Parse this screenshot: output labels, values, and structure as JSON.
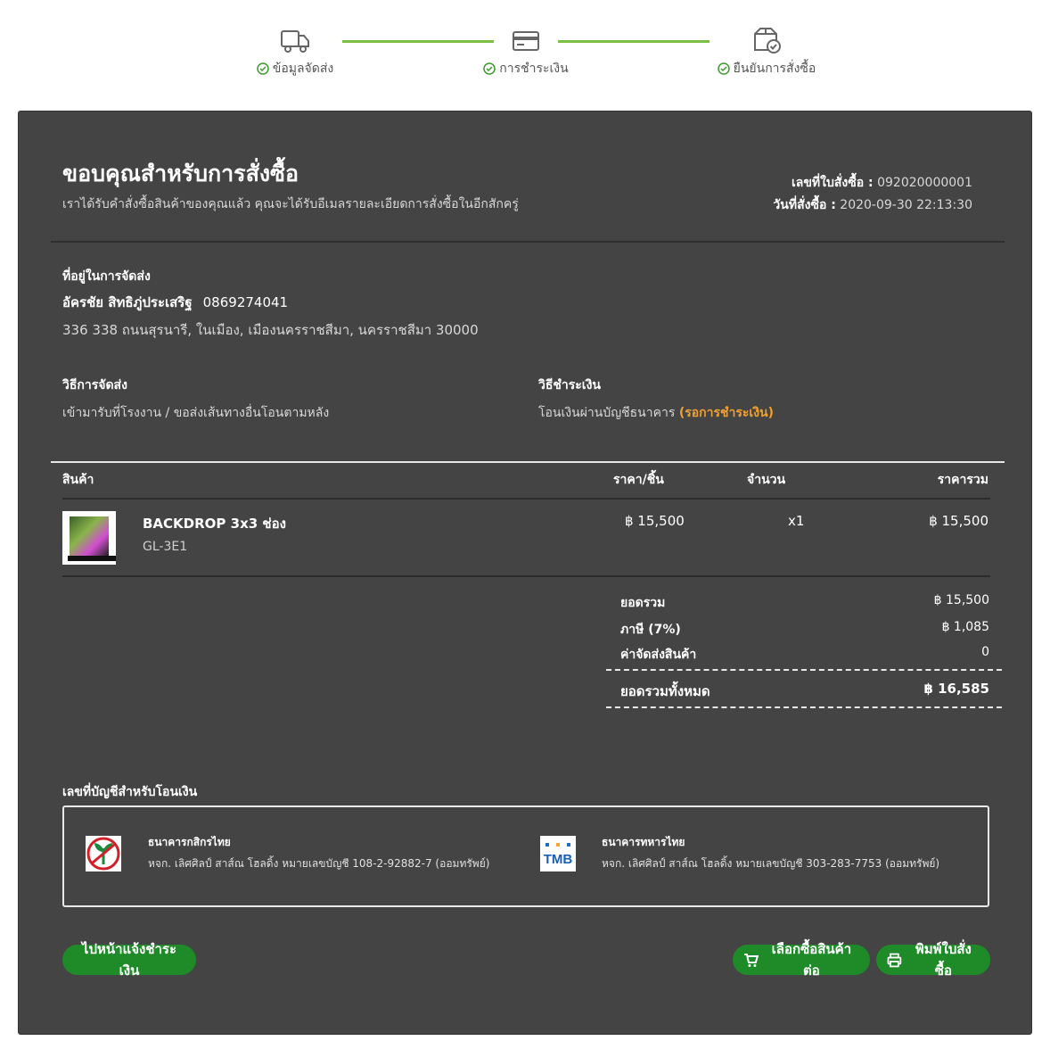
{
  "steps": [
    {
      "label": "ข้อมูลจัดส่ง",
      "icon": "truck-icon"
    },
    {
      "label": "การชำระเงิน",
      "icon": "credit-card-icon"
    },
    {
      "label": "ยืนยันการสั่งซื้อ",
      "icon": "box-check-icon"
    }
  ],
  "header": {
    "title": "ขอบคุณสำหรับการสั่งซื้อ",
    "subtitle": "เราได้รับคำสั่งซื้อสินค้าของคุณแล้ว คุณจะได้รับอีเมลรายละเอียดการสั่งซื้อในอีกสักครู่",
    "order_no_label": "เลขที่ใบสั่งซื้อ :",
    "order_no": "092020000001",
    "order_date_label": "วันที่สั่งซื้อ :",
    "order_date": "2020-09-30 22:13:30"
  },
  "shipping_address": {
    "label": "ที่อยู่ในการจัดส่ง",
    "name": "อัครชัย สิทธิภู่ประเสริฐ",
    "phone": "0869274041",
    "address": "336 338 ถนนสุรนารี, ในเมือง, เมืองนครราชสีมา, นครราชสีมา 30000"
  },
  "shipping_method": {
    "label": "วิธีการจัดส่ง",
    "value": "เข้ามารับที่โรงงาน / ขอส่งเส้นทางอื่นโอนตามหลัง"
  },
  "payment_method": {
    "label": "วิธีชำระเงิน",
    "value": "โอนเงินผ่านบัญชีธนาคาร",
    "status": "(รอการชำระเงิน)",
    "status_color": "#f0a030"
  },
  "table": {
    "headers": {
      "product": "สินค้า",
      "price": "ราคา/ชิ้น",
      "qty": "จำนวน",
      "total": "ราคารวม"
    },
    "items": [
      {
        "name": "BACKDROP 3x3 ช่อง",
        "sku": "GL-3E1",
        "price": "฿ 15,500",
        "qty": "x1",
        "total": "฿ 15,500"
      }
    ]
  },
  "totals": {
    "subtotal_label": "ยอดรวม",
    "subtotal": "฿ 15,500",
    "tax_label": "ภาษี (7%)",
    "tax": "฿ 1,085",
    "shipping_label": "ค่าจัดส่งสินค้า",
    "shipping": "0",
    "grand_label": "ยอดรวมทั้งหมด",
    "grand": "฿ 16,585"
  },
  "bank": {
    "title": "เลขที่บัญชีสำหรับโอนเงิน",
    "accounts": [
      {
        "name": "ธนาคารกสิกรไทย",
        "detail": "หจก. เลิศศิลป์ สาส์ณ โฮลดิ้ง หมายเลขบัญชี 108-2-92882-7 (ออมทรัพย์)",
        "logo": "kasikorn-logo"
      },
      {
        "name": "ธนาคารทหารไทย",
        "detail": "หจก. เลิศศิลป์ สาส์ณ โฮลดิ้ง หมายเลขบัญชี 303-283-7753 (ออมทรัพย์)",
        "logo": "tmb-logo",
        "logo_text": "TMB"
      }
    ]
  },
  "buttons": {
    "notify_payment": "ไปหน้าแจ้งชำระเงิน",
    "continue_shopping": "เลือกซื้อสินค้าต่อ",
    "print_order": "พิมพ์ใบสั่งซื้อ"
  },
  "colors": {
    "accent": "#1e8a28",
    "step_line": "#7cc043",
    "card_bg": "#444444"
  }
}
